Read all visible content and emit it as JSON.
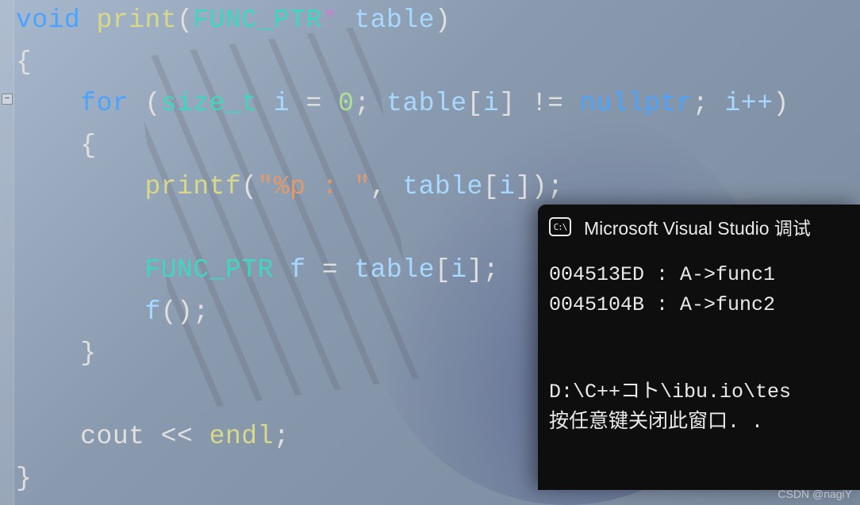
{
  "code": {
    "l1": {
      "kw_void": "void",
      "fn": "print",
      "type": "FUNC_PTR",
      "star": "*",
      "param": "table"
    },
    "l2": {
      "brace": "{"
    },
    "l3": {
      "kw_for": "for",
      "type": "size_t",
      "var": "i",
      "eq": "=",
      "zero": "0",
      "arr": "table",
      "idx": "i",
      "ne": "!=",
      "null": "nullptr",
      "inc": "i++"
    },
    "l4": {
      "brace": "{"
    },
    "l5": {
      "fn": "printf",
      "str": "\"%p : \"",
      "arr": "table",
      "idx": "i"
    },
    "l7": {
      "type": "FUNC_PTR",
      "var": "f",
      "eq": "=",
      "arr": "table",
      "idx": "i"
    },
    "l8": {
      "var": "f"
    },
    "l9": {
      "brace": "}"
    },
    "l11": {
      "cout": "cout",
      "shl": "<<",
      "endl": "endl"
    },
    "l12": {
      "brace": "}"
    }
  },
  "fold": {
    "minus": "−"
  },
  "console": {
    "title": "Microsoft Visual Studio 调试",
    "icon_text": "C:\\",
    "lines": {
      "a": "004513ED : A->func1",
      "b": "0045104B : A->func2",
      "path": "D:\\C++コト\\ibu.io\\tes",
      "press": "按任意键关闭此窗口. ."
    }
  },
  "watermark": "CSDN @nagiY"
}
